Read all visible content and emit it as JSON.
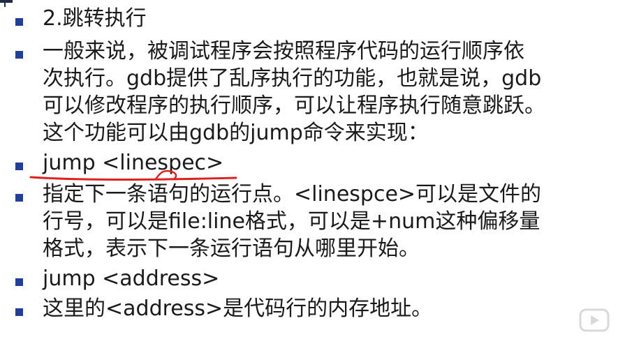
{
  "slide": {
    "items": [
      {
        "lines": [
          "2.跳转执行"
        ]
      },
      {
        "lines": [
          "一般来说，被调试程序会按照程序代码的运行顺序依",
          "次执行。gdb提供了乱序执行的功能，也就是说，gdb",
          "可以修改程序的执行顺序，可以让程序执行随意跳跃。",
          "这个功能可以由gdb的jump命令来实现："
        ]
      },
      {
        "lines": [
          "jump <linespec>"
        ]
      },
      {
        "lines": [
          "指定下一条语句的运行点。<linespce>可以是文件的",
          "行号，可以是file:line格式，可以是+num这种偏移量",
          "格式，表示下一条运行语句从哪里开始。"
        ]
      },
      {
        "lines": [
          "jump <address>"
        ]
      },
      {
        "lines": [
          "这里的<address>是代码行的内存地址。"
        ]
      }
    ]
  },
  "colors": {
    "bullet": "#1f3f9a",
    "text": "#1a1a1a",
    "annotation": "#e0201c",
    "background": "#ffffff"
  },
  "icons": {
    "bullet": "square-bullet-icon",
    "watermark": "play-watermark-icon"
  }
}
